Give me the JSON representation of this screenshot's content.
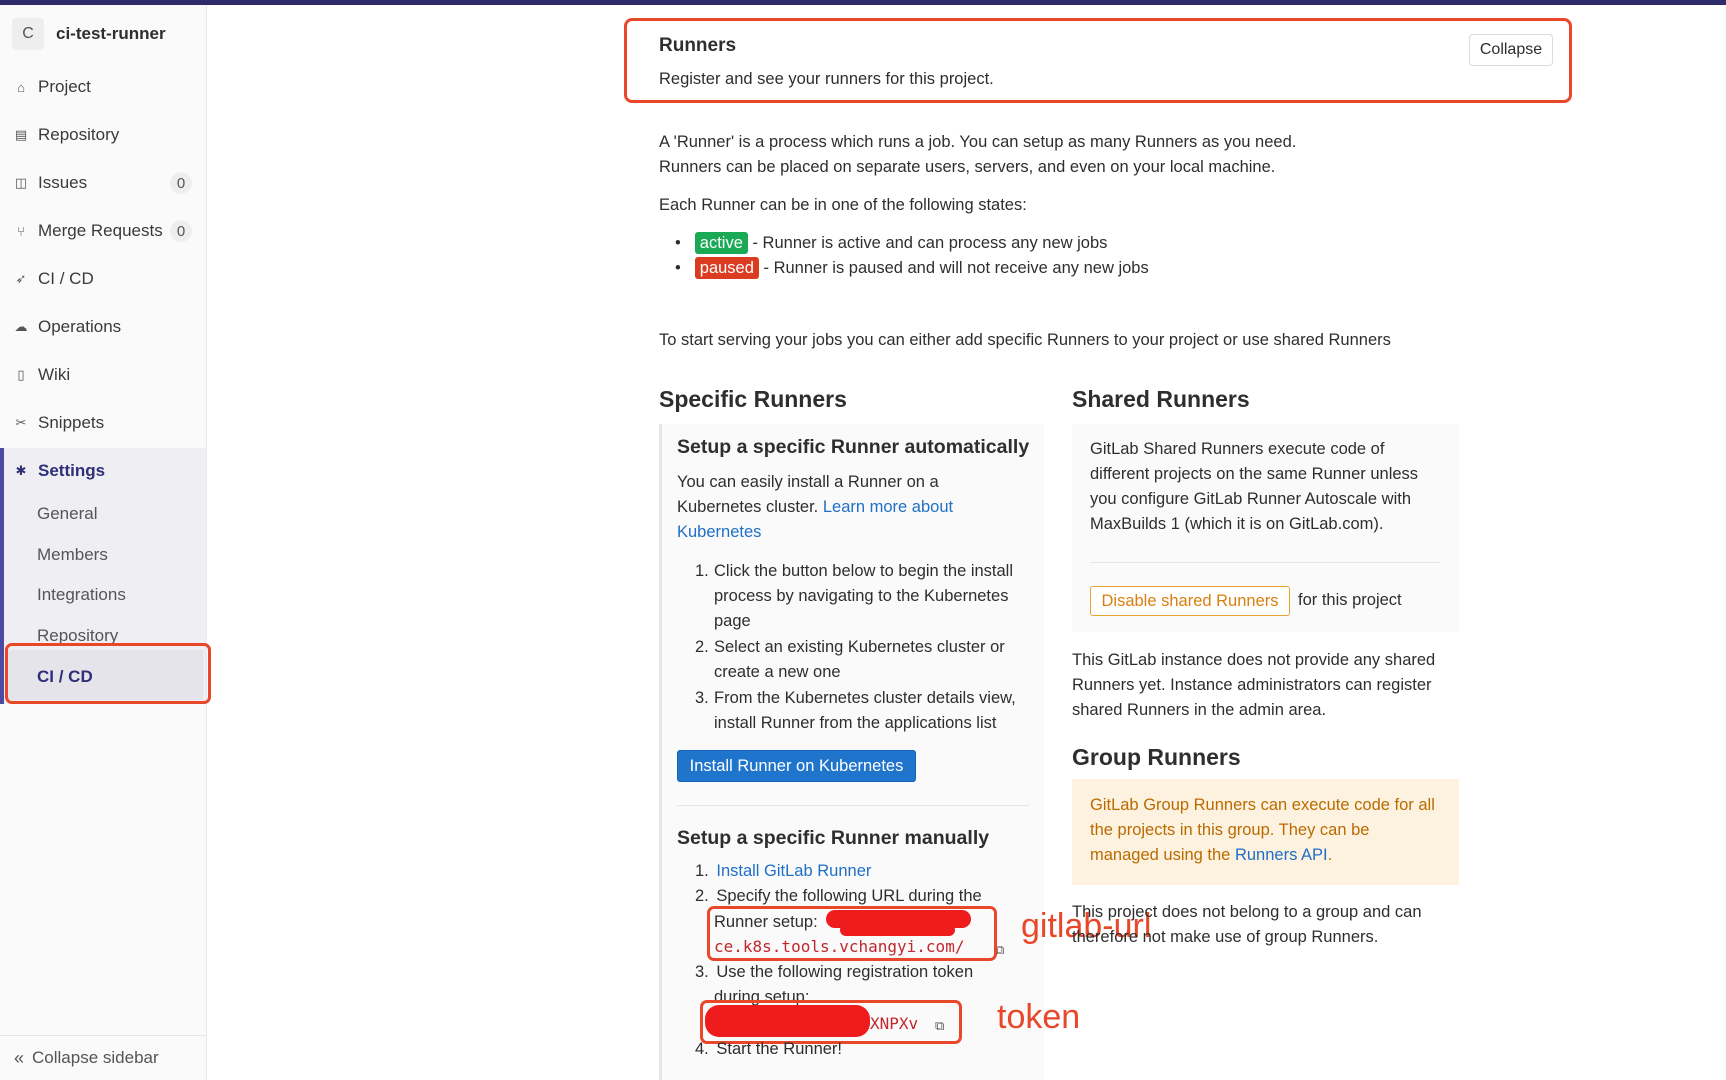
{
  "sidebar": {
    "project_initial": "C",
    "project_name": "ci-test-runner",
    "items": [
      {
        "label": "Project",
        "icon": "home-icon"
      },
      {
        "label": "Repository",
        "icon": "document-icon"
      },
      {
        "label": "Issues",
        "icon": "issues-icon",
        "count": "0"
      },
      {
        "label": "Merge Requests",
        "icon": "merge-request-icon",
        "count": "0"
      },
      {
        "label": "CI / CD",
        "icon": "rocket-icon"
      },
      {
        "label": "Operations",
        "icon": "cloud-gear-icon"
      },
      {
        "label": "Wiki",
        "icon": "book-icon"
      },
      {
        "label": "Snippets",
        "icon": "scissors-icon"
      },
      {
        "label": "Settings",
        "icon": "gear-icon"
      }
    ],
    "settings_sub": [
      "General",
      "Members",
      "Integrations",
      "Repository",
      "CI / CD"
    ],
    "collapse_label": "Collapse sidebar"
  },
  "runners": {
    "title": "Runners",
    "subtitle": "Register and see your runners for this project.",
    "collapse_button": "Collapse",
    "intro_line1": "A 'Runner' is a process which runs a job. You can setup as many Runners as you need.",
    "intro_line2": "Runners can be placed on separate users, servers, and even on your local machine.",
    "states_intro": "Each Runner can be in one of the following states:",
    "state_active_badge": "active",
    "state_active_text": " - Runner is active and can process any new jobs",
    "state_paused_badge": "paused",
    "state_paused_text": " - Runner is paused and will not receive any new jobs",
    "start_serving": "To start serving your jobs you can either add specific Runners to your project or use shared Runners"
  },
  "specific": {
    "heading": "Specific Runners",
    "auto_heading": "Setup a specific Runner automatically",
    "auto_desc_1": "You can easily install a Runner on a",
    "auto_desc_2": "Kubernetes cluster. ",
    "auto_link_1": "Learn more about",
    "auto_link_2": "Kubernetes",
    "steps": [
      {
        "n": "1.",
        "lines": [
          "Click the button below to begin the install",
          "process by navigating to the Kubernetes",
          "page"
        ]
      },
      {
        "n": "2.",
        "lines": [
          "Select an existing Kubernetes cluster or",
          "create a new one"
        ]
      },
      {
        "n": "3.",
        "lines": [
          "From the Kubernetes cluster details view,",
          "install Runner from the applications list"
        ]
      }
    ],
    "install_button": "Install Runner on Kubernetes",
    "manual_heading": "Setup a specific Runner manually",
    "manual_1_n": "1.",
    "manual_1_link": "Install GitLab Runner",
    "manual_2_n": "2.",
    "manual_2_text": "Specify the following URL during the",
    "runner_setup_label": "Runner setup:",
    "url_visible": "ce.k8s.tools.vchangyi.com/",
    "manual_3_n": "3.",
    "manual_3_text": "Use the following registration token",
    "manual_3_text2": "during setup:",
    "token_visible": "XNPXv",
    "manual_4_n": "4.",
    "manual_4_text": "Start the Runner!"
  },
  "shared": {
    "heading": "Shared Runners",
    "desc": [
      "GitLab Shared Runners execute code of",
      "different projects on the same Runner unless",
      "you configure GitLab Runner Autoscale with",
      "MaxBuilds 1 (which it is on GitLab.com)."
    ],
    "disable_button": "Disable shared Runners",
    "for_project": "for this project",
    "none_text": [
      "This GitLab instance does not provide any shared",
      "Runners yet. Instance administrators can register",
      "shared Runners in the admin area."
    ]
  },
  "group": {
    "heading": "Group Runners",
    "warn_1": "GitLab Group Runners can execute code for all",
    "warn_2": "the projects in this group. They can be",
    "warn_3": "managed using the ",
    "warn_link": "Runners API",
    "warn_end": ".",
    "note_1": "This project does not belong to a group and can",
    "note_2": "therefore not make use of group Runners."
  },
  "annotations": {
    "gitlab_url": "gitlab-url",
    "token": "token"
  },
  "colors": {
    "accent_red": "#e8472a",
    "active_green": "#1aaa55",
    "paused_red": "#db3b21",
    "primary_blue": "#1f75cb"
  }
}
